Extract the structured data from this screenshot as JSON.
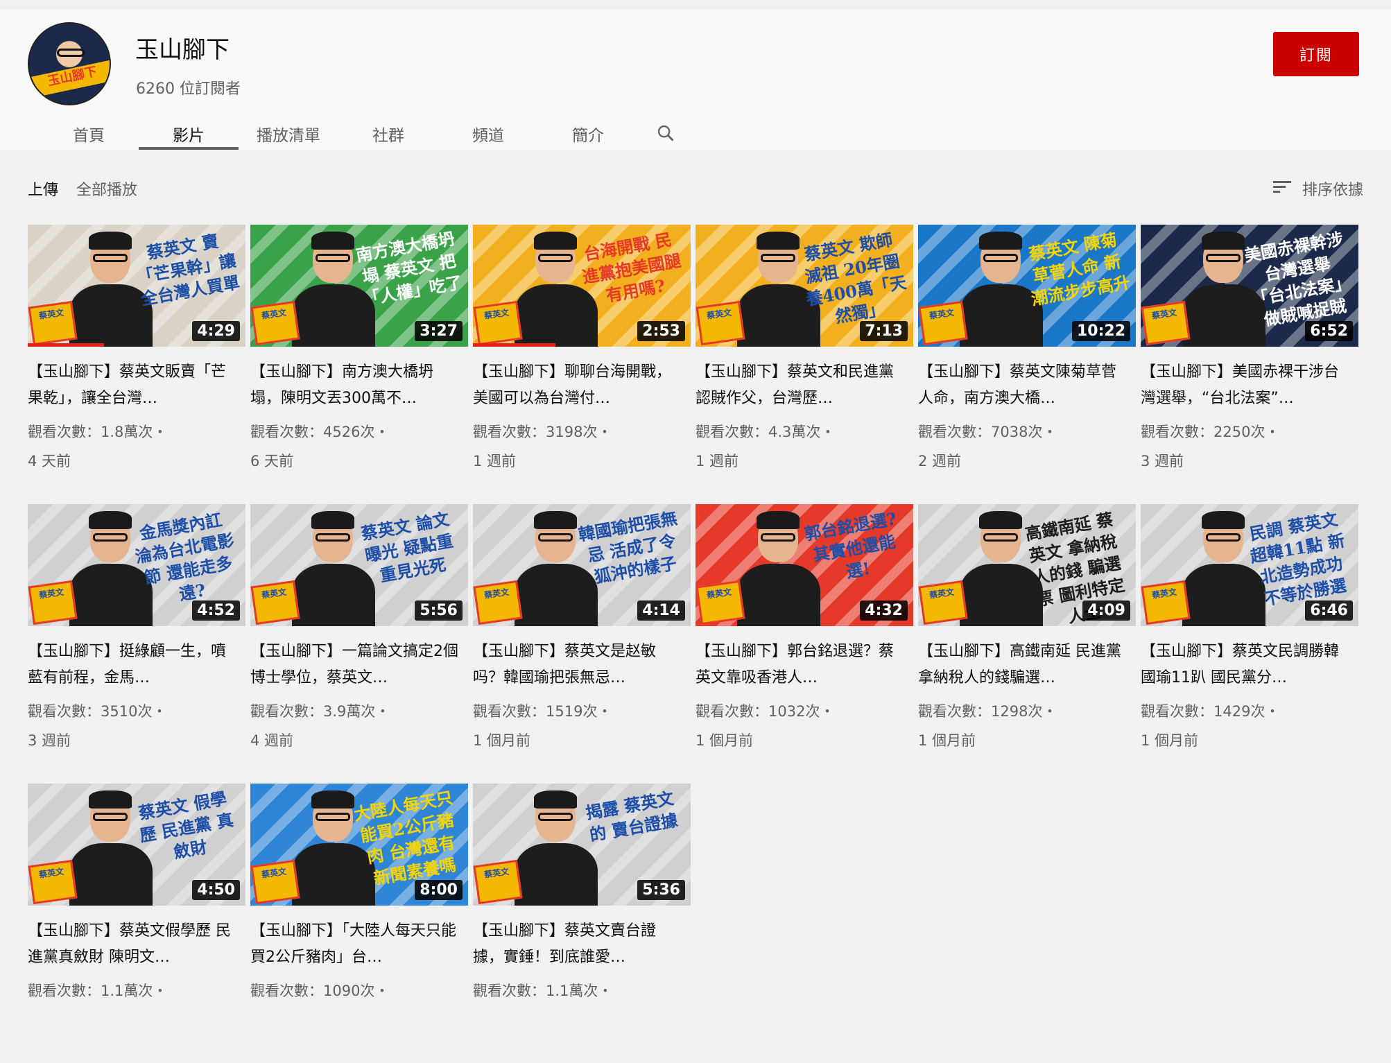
{
  "channel": {
    "name": "玉山腳下",
    "subscribers": "6260 位訂閱者",
    "subscribe_label": "訂閱",
    "avatar_text": "玉山腳下"
  },
  "tabs": [
    {
      "label": "首頁"
    },
    {
      "label": "影片"
    },
    {
      "label": "播放清單"
    },
    {
      "label": "社群"
    },
    {
      "label": "頻道"
    },
    {
      "label": "簡介"
    }
  ],
  "toolbar": {
    "uploads_label": "上傳",
    "play_all_label": "全部播放",
    "sort_label": "排序依據"
  },
  "videos": [
    {
      "title": "【玉山腳下】蔡英文販賣「芒果乾」，讓全台灣…",
      "views": "觀看次數：1.8萬次・",
      "age": "4 天前",
      "duration": "4:29",
      "headline": "蔡英文 賣「芒果幹」讓全台灣人買單",
      "badge": "蔡英文",
      "bg": "#d9d2c6",
      "headline_color": "#1d4fa8",
      "progress": 0.35
    },
    {
      "title": "【玉山腳下】南方澳大橋坍塌，陳明文丟300萬不…",
      "views": "觀看次數：4526次・",
      "age": "6 天前",
      "duration": "3:27",
      "headline": "南方澳大橋坍塌 蔡英文 把「人權」吃了",
      "badge": "蔡英文",
      "bg": "#3aa34a",
      "headline_color": "#ffffff",
      "progress": 0.0
    },
    {
      "title": "【玉山腳下】聊聊台海開戰，美國可以為台灣付…",
      "views": "觀看次數：3198次・",
      "age": "1 週前",
      "duration": "2:53",
      "headline": "台海開戰 民進黨抱美國腿 有用嗎?",
      "badge": "蔡英文",
      "bg": "#f2b01e",
      "headline_color": "#e5392a",
      "progress": 0.38
    },
    {
      "title": "【玉山腳下】蔡英文和民進黨認賊作父，台灣歷…",
      "views": "觀看次數：4.3萬次・",
      "age": "1 週前",
      "duration": "7:13",
      "headline": "蔡英文 欺師滅祖 20年圈養400萬「天然獨」",
      "badge": "蔡英文",
      "bg": "#f2b01e",
      "headline_color": "#1d4fa8",
      "progress": 0.0
    },
    {
      "title": "【玉山腳下】蔡英文陳菊草菅人命，南方澳大橋…",
      "views": "觀看次數：7038次・",
      "age": "2 週前",
      "duration": "10:22",
      "headline": "蔡英文 陳菊 草菅人命 新潮流步步高升",
      "badge": "蔡英文",
      "bg": "#1b77c8",
      "headline_color": "#f5d400",
      "progress": 0.0
    },
    {
      "title": "【玉山腳下】美國赤裸干涉台灣選舉，“台北法案”…",
      "views": "觀看次數：2250次・",
      "age": "3 週前",
      "duration": "6:52",
      "headline": "美國赤裸幹涉台灣選舉 「台北法案」做賊喊捉賊",
      "badge": "蔡英文",
      "bg": "#1b2a4a",
      "headline_color": "#ffffff",
      "progress": 0.0
    },
    {
      "title": "【玉山腳下】挺綠顧一生，噴藍有前程，金馬…",
      "views": "觀看次數：3510次・",
      "age": "3 週前",
      "duration": "4:52",
      "headline": "金馬獎內訌 淪為台北電影節 還能走多遠?",
      "badge": "蔡英文",
      "bg": "#d0d0d0",
      "headline_color": "#1d4fa8",
      "progress": 0.0
    },
    {
      "title": "【玉山腳下】一篇論文搞定2個博士學位，蔡英文…",
      "views": "觀看次數：3.9萬次・",
      "age": "4 週前",
      "duration": "5:56",
      "headline": "蔡英文 論文曝光 疑點重重見光死",
      "badge": "蔡英文",
      "bg": "#d0d0d0",
      "headline_color": "#1d4fa8",
      "progress": 0.0
    },
    {
      "title": "【玉山腳下】蔡英文是赵敏吗？韓國瑜把張無忌…",
      "views": "觀看次數：1519次・",
      "age": "1 個月前",
      "duration": "4:14",
      "headline": "韓國瑜把張無忌 活成了令狐沖的樣子",
      "badge": "蔡英文",
      "bg": "#d0d0d0",
      "headline_color": "#1d4fa8",
      "progress": 0.0
    },
    {
      "title": "【玉山腳下】郭台銘退選？蔡英文靠吸香港人…",
      "views": "觀看次數：1032次・",
      "age": "1 個月前",
      "duration": "4:32",
      "headline": "郭台銘退選? 其實他還能選!",
      "badge": "蔡英文",
      "bg": "#e5392a",
      "headline_color": "#1d4fa8",
      "progress": 0.0
    },
    {
      "title": "【玉山腳下】高鐵南延 民進黨拿納稅人的錢騙選…",
      "views": "觀看次數：1298次・",
      "age": "1 個月前",
      "duration": "4:09",
      "headline": "高鐵南延 蔡英文 拿納稅人的錢 騙選票 圖利特定人士",
      "badge": "蔡英文",
      "bg": "#d0d0d0",
      "headline_color": "#1d1d1d",
      "progress": 0.0
    },
    {
      "title": "【玉山腳下】蔡英文民調勝韓國瑜11趴 國民黨分…",
      "views": "觀看次數：1429次・",
      "age": "1 個月前",
      "duration": "6:46",
      "headline": "民調 蔡英文超韓11點 新北造勢成功 不等於勝選",
      "badge": "蔡英文",
      "bg": "#d0d0d0",
      "headline_color": "#1d4fa8",
      "progress": 0.0
    },
    {
      "title": "【玉山腳下】蔡英文假學歷 民進黨真斂財 陳明文…",
      "views": "觀看次數：1.1萬次・",
      "age": "",
      "duration": "4:50",
      "headline": "蔡英文 假學歷 民進黨 真斂財",
      "badge": "蔡英文",
      "bg": "#d0d0d0",
      "headline_color": "#1d4fa8",
      "progress": 0.0
    },
    {
      "title": "【玉山腳下】「大陸人每天只能買2公斤豬肉」台…",
      "views": "觀看次數：1090次・",
      "age": "",
      "duration": "8:00",
      "headline": "大陸人每天只能買2公斤豬肉 台灣還有新聞素養嗎",
      "badge": "蔡英文",
      "bg": "#2f86d6",
      "headline_color": "#f5d400",
      "progress": 0.0
    },
    {
      "title": "【玉山腳下】蔡英文賣台證據，實錘！到底誰愛…",
      "views": "觀看次數：1.1萬次・",
      "age": "",
      "duration": "5:36",
      "headline": "揭露 蔡英文的 賣台證據",
      "badge": "蔡英文",
      "bg": "#d0d0d0",
      "headline_color": "#1d4fa8",
      "progress": 0.0
    }
  ],
  "colors": {
    "accent_red": "#cc0000",
    "progress_red": "#e62117",
    "background": "#f1f1f1"
  }
}
